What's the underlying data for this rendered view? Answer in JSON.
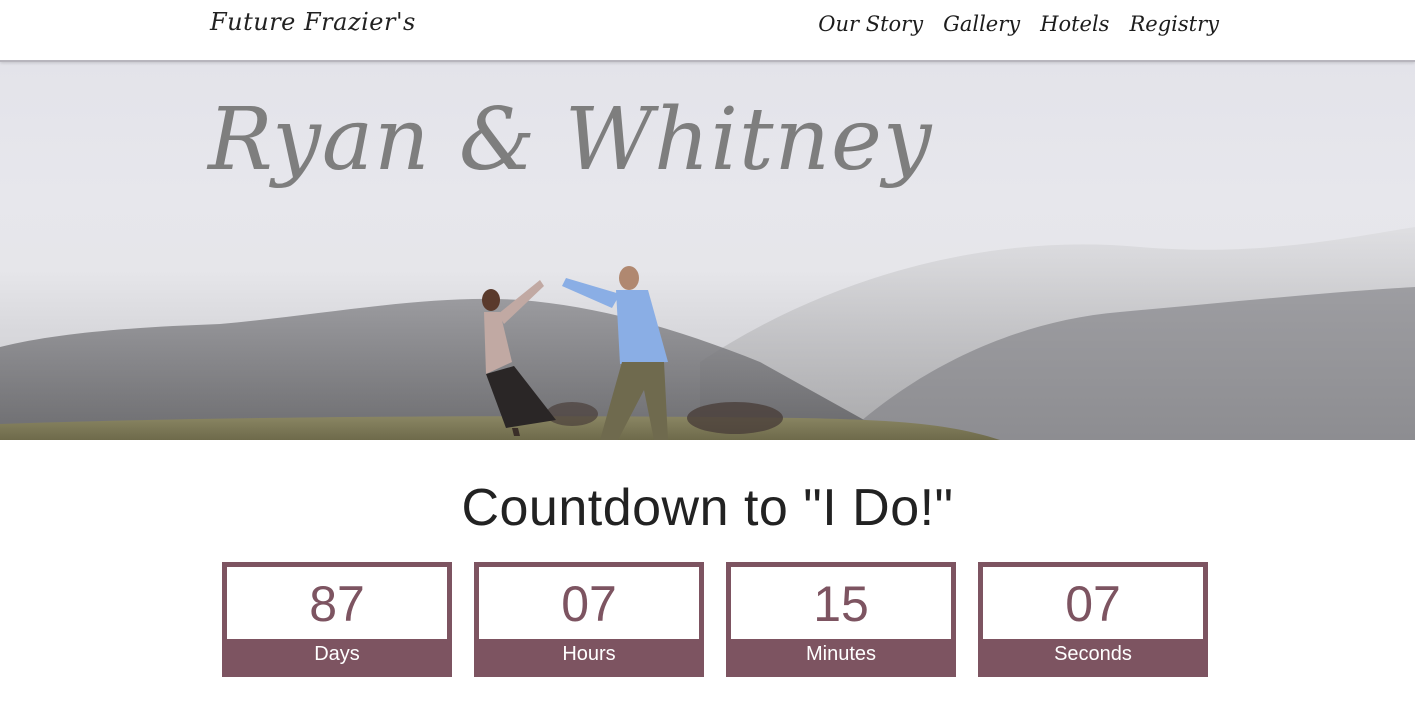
{
  "nav": {
    "brand": "Future Frazier's",
    "links": [
      {
        "label": "Our Story"
      },
      {
        "label": "Gallery"
      },
      {
        "label": "Hotels"
      },
      {
        "label": "Registry"
      }
    ]
  },
  "hero": {
    "title": "Ryan & Whitney",
    "image": "couple-dancing-on-foggy-hillside"
  },
  "countdown": {
    "title": "Countdown to \"I Do!\"",
    "units": [
      {
        "value": "87",
        "label": "Days"
      },
      {
        "value": "07",
        "label": "Hours"
      },
      {
        "value": "15",
        "label": "Minutes"
      },
      {
        "value": "07",
        "label": "Seconds"
      }
    ]
  },
  "colors": {
    "accent": "#7d5461",
    "hero_title": "#7e7e7e",
    "nav_text": "#1c1c1c"
  }
}
